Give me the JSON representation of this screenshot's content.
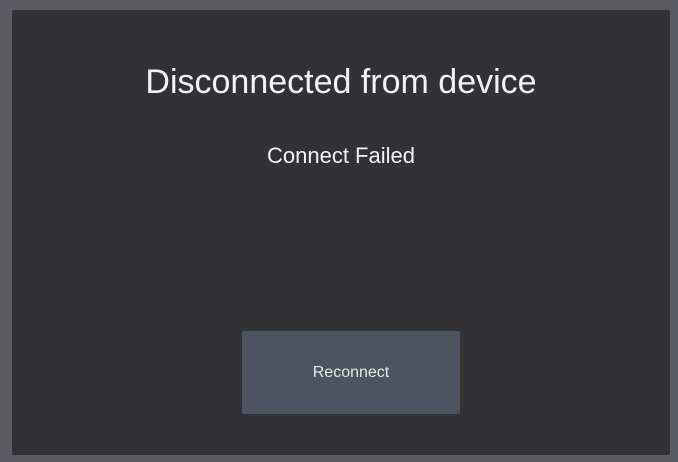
{
  "dialog": {
    "title": "Disconnected from device",
    "status": "Connect Failed",
    "reconnect_label": "Reconnect"
  },
  "colors": {
    "frame": "#5a5c62",
    "panel_background": "#313136",
    "button_background": "#4d5361",
    "text": "#f2f2f2"
  }
}
